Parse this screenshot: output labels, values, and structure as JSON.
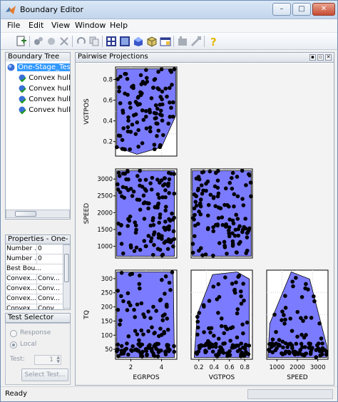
{
  "window": {
    "title": "Boundary Editor",
    "controls": {
      "minimize": "–",
      "maximize": "□",
      "close": "✕"
    }
  },
  "menu": [
    "File",
    "Edit",
    "View",
    "Window",
    "Help"
  ],
  "toolbar_icons": [
    "new-boundary-icon",
    "add-point-icon",
    "paste-icon",
    "delete-icon",
    "redo-icon",
    "copy-icon",
    "pairwise-icon",
    "single-view-icon",
    "3d-view-icon",
    "cube-icon",
    "table-icon",
    "boundary-icon",
    "measure-icon",
    "help-icon"
  ],
  "boundary_tree": {
    "title": "Boundary Tree",
    "items": [
      {
        "label": "One-Stage_TestPl",
        "selected": true,
        "level": 0
      },
      {
        "label": "Convex hull(SP",
        "selected": false,
        "level": 1
      },
      {
        "label": "Convex hull(EG",
        "selected": false,
        "level": 1
      },
      {
        "label": "Convex hull(VG",
        "selected": false,
        "level": 1
      },
      {
        "label": "Convex hull(EG",
        "selected": false,
        "level": 1
      }
    ]
  },
  "properties": {
    "title": "Properties - One-Sta...",
    "rows": [
      [
        "Number ...",
        "0"
      ],
      [
        "Number ...",
        "0"
      ],
      [
        "Best Bou...",
        ""
      ],
      [
        "Convex...",
        "Conv..."
      ],
      [
        "Convex...",
        "Conv..."
      ],
      [
        "Convex...",
        "Conv..."
      ],
      [
        "Convex...",
        "Conv..."
      ]
    ]
  },
  "test_selector": {
    "title": "Test Selector",
    "response_label": "Response",
    "local_label": "Local",
    "test_label": "Test:",
    "test_value": "1",
    "select_button": "Select Test..."
  },
  "projections": {
    "title": "Pairwise Projections",
    "controls": [
      "▪",
      "▫",
      "✕"
    ],
    "point_color": "#000000",
    "hull_color": "#7b7bff"
  },
  "chart_data": [
    {
      "type": "scatter",
      "xlabel": "",
      "ylabel": "VGTPOS",
      "yticks": [
        "0.2",
        "0.4",
        "0.6",
        "0.8"
      ],
      "xticks": []
    },
    {
      "type": "scatter",
      "xlabel": "",
      "ylabel": "SPEED",
      "yticks": [
        "1000",
        "1500",
        "2000",
        "2500",
        "3000"
      ],
      "xticks": []
    },
    {
      "type": "scatter",
      "xlabel": "",
      "ylabel": "",
      "yticks": [],
      "xticks": []
    },
    {
      "type": "scatter",
      "xlabel": "EGRPOS",
      "ylabel": "TQ",
      "yticks": [
        "50",
        "100",
        "150",
        "200",
        "250",
        "300"
      ],
      "xticks": [
        "2",
        "4"
      ]
    },
    {
      "type": "scatter",
      "xlabel": "VGTPOS",
      "ylabel": "",
      "yticks": [],
      "xticks": [
        "0.2",
        "0.4",
        "0.6",
        "0.8"
      ]
    },
    {
      "type": "scatter",
      "xlabel": "SPEED",
      "ylabel": "",
      "yticks": [],
      "xticks": [
        "1000",
        "2000",
        "3000"
      ]
    }
  ],
  "status": {
    "text": "Ready"
  }
}
